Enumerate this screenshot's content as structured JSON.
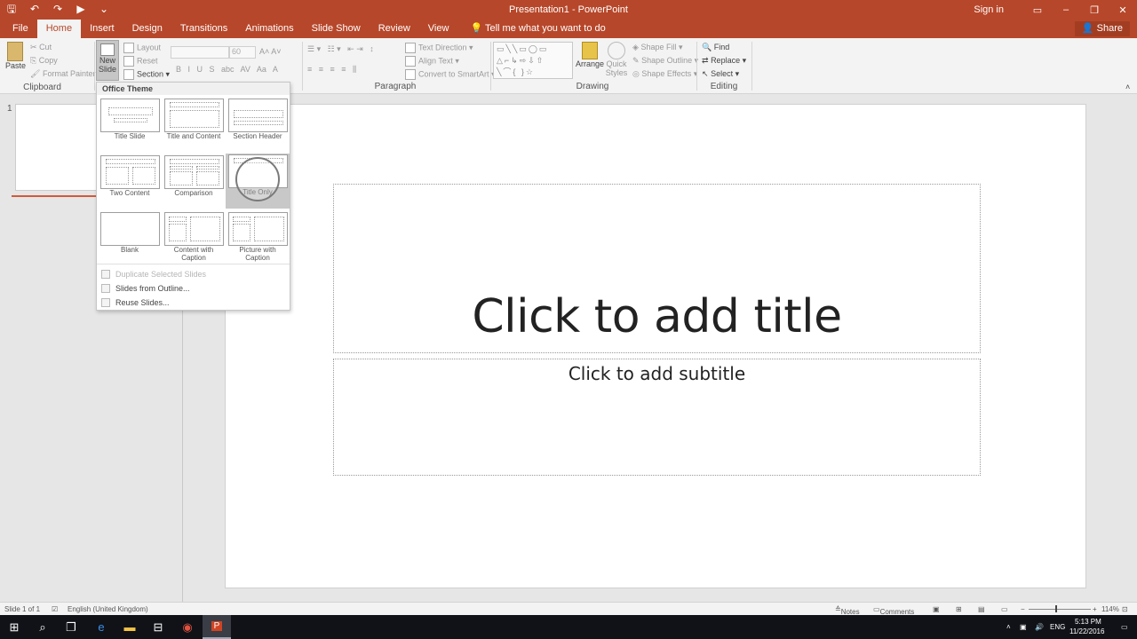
{
  "window": {
    "title": "Presentation1 - PowerPoint",
    "signin": "Sign in",
    "share": "Share"
  },
  "qat": {
    "save": "🖫",
    "undo": "↶",
    "redo": "↷",
    "start": "▶",
    "more": "⌄"
  },
  "tabs": [
    "File",
    "Home",
    "Insert",
    "Design",
    "Transitions",
    "Animations",
    "Slide Show",
    "Review",
    "View"
  ],
  "tellme": "Tell me what you want to do",
  "ribbon": {
    "clipboard": {
      "paste": "Paste",
      "cut": "Cut",
      "copy": "Copy",
      "format_painter": "Format Painter",
      "label": "Clipboard"
    },
    "slides": {
      "new_slide_1": "New",
      "new_slide_2": "Slide",
      "layout": "Layout",
      "reset": "Reset",
      "section": "Section"
    },
    "font": {
      "size": "60"
    },
    "paragraph": {
      "text_direction": "Text Direction",
      "align_text": "Align Text",
      "convert": "Convert to SmartArt",
      "label": "Paragraph"
    },
    "drawing": {
      "arrange": "Arrange",
      "quick_1": "Quick",
      "quick_2": "Styles",
      "shape_fill": "Shape Fill",
      "shape_outline": "Shape Outline",
      "shape_effects": "Shape Effects",
      "label": "Drawing"
    },
    "editing": {
      "find": "Find",
      "replace": "Replace",
      "select": "Select",
      "label": "Editing"
    }
  },
  "dropdown": {
    "header": "Office Theme",
    "layouts": [
      "Title Slide",
      "Title and Content",
      "Section Header",
      "Two Content",
      "Comparison",
      "Title Only",
      "Blank",
      "Content with Caption",
      "Picture with Caption"
    ],
    "highlighted": "Title Only",
    "menu": [
      "Duplicate Selected Slides",
      "Slides from Outline...",
      "Reuse Slides..."
    ]
  },
  "thumb_number": "1",
  "slide": {
    "title": "Click to add title",
    "subtitle": "Click to add subtitle"
  },
  "status": {
    "slide": "Slide 1 of 1",
    "language": "English (United Kingdom)",
    "notes": "Notes",
    "comments": "Comments",
    "zoom": "114%"
  },
  "taskbar": {
    "lang": "ENG",
    "time": "5:13 PM",
    "date": "11/22/2016"
  }
}
